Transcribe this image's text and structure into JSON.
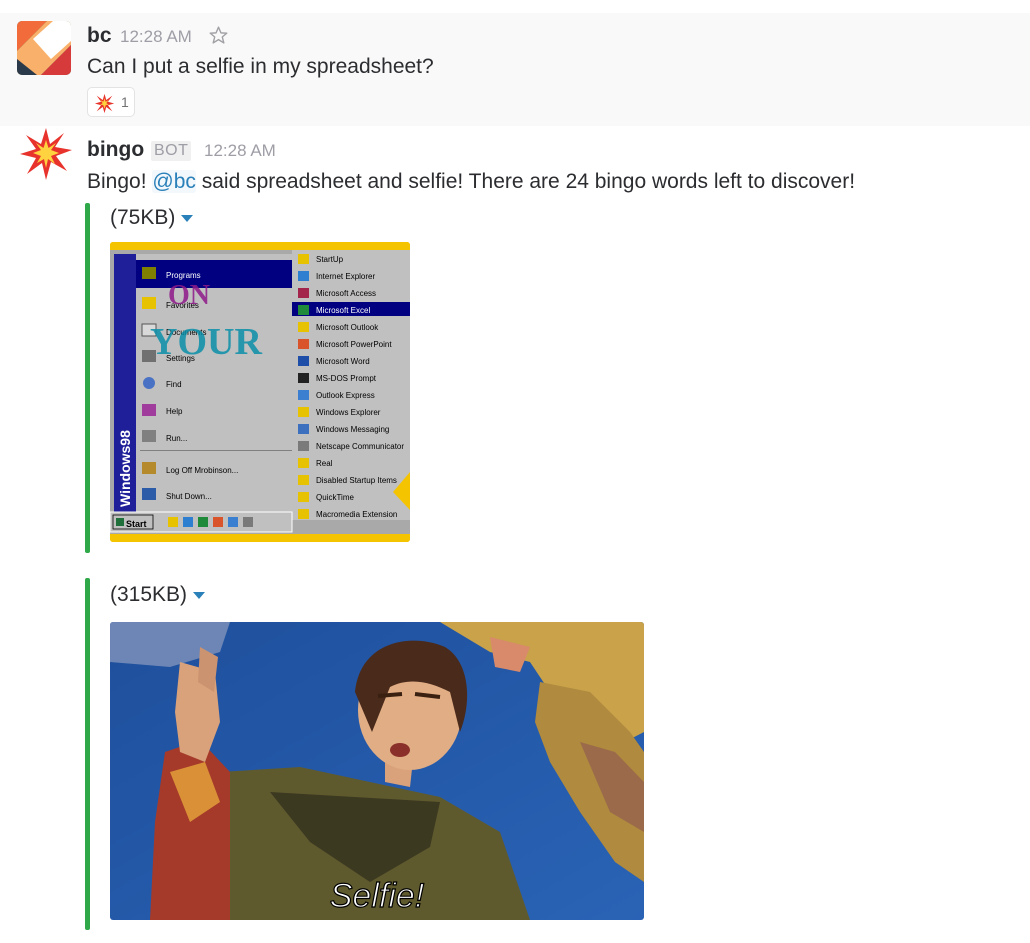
{
  "messages": [
    {
      "author": "bc",
      "time": "12:28 AM",
      "text": "Can I put a selfie in my spreadsheet?",
      "reaction": {
        "icon": "collision-emoji-icon",
        "count": "1"
      }
    },
    {
      "author": "bingo",
      "badge": "BOT",
      "time": "12:28 AM",
      "text_before": "Bingo! ",
      "mention": "@bc",
      "text_after": " said spreadsheet and selfie! There are 24 bingo words left to discover!",
      "attachments": [
        {
          "size": "(75KB)",
          "image": {
            "taskbar_label": "Windows98",
            "start_label": "Start",
            "overlay_words": [
              "ON",
              "YOUR"
            ],
            "start_menu": [
              "Programs",
              "Favorites",
              "Documents",
              "Settings",
              "Find",
              "Help",
              "Run...",
              "Log Off Mrobinson...",
              "Shut Down..."
            ],
            "programs_menu": [
              "StartUp",
              "Internet Explorer",
              "Microsoft Access",
              "Microsoft Excel",
              "Microsoft Outlook",
              "Microsoft PowerPoint",
              "Microsoft Word",
              "MS-DOS Prompt",
              "Outlook Express",
              "Windows Explorer",
              "Windows Messaging",
              "Netscape Communicator",
              "Real",
              "Disabled Startup Items",
              "QuickTime",
              "Macromedia Extension"
            ],
            "highlighted_program": "Microsoft Excel"
          }
        },
        {
          "size": "(315KB)",
          "image": {
            "caption": "Selfie!"
          }
        }
      ]
    }
  ],
  "colors": {
    "attachment_bar": "#2fa849",
    "mention": "#2a80b9",
    "timestamp": "#9e9ea6"
  }
}
